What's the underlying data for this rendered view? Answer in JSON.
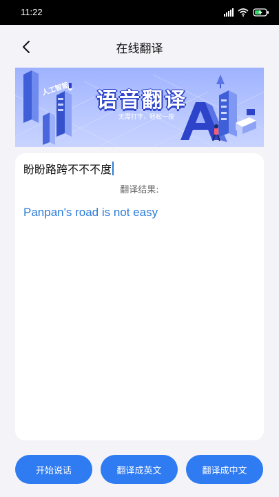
{
  "status_bar": {
    "time": "11:22"
  },
  "header": {
    "title": "在线翻译"
  },
  "banner": {
    "title": "语音翻译",
    "subtitle": "无需打字，轻松一按",
    "tag": "人工智能"
  },
  "translator": {
    "input_text": "盼盼路跨不不不度",
    "result_label": "翻译结果:",
    "result_text": "Panpan's road is not easy"
  },
  "actions": {
    "start_speaking": "开始说话",
    "translate_to_english": "翻译成英文",
    "translate_to_chinese": "翻译成中文"
  },
  "colors": {
    "accent": "#2f7bf2",
    "result_text": "#2a7bd6",
    "background": "#f3f3f8"
  }
}
